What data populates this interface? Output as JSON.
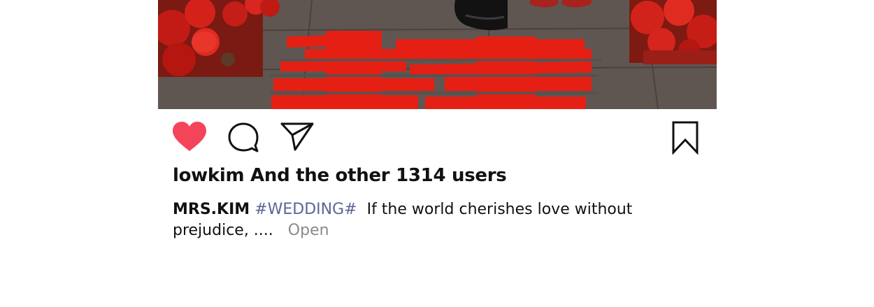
{
  "post": {
    "photo": {
      "description_icon": "wedding-photo"
    },
    "actions": {
      "like_icon": "heart-filled-icon",
      "comment_icon": "comment-bubble-icon",
      "share_icon": "paper-plane-icon",
      "bookmark_icon": "bookmark-icon",
      "like_color": "#f4445a"
    },
    "likes_text": "lowkim And the other 1314 users",
    "caption": {
      "username": "MRS.KIM",
      "hashtag": "#WEDDING#",
      "text": "If the world cherishes love without prejudice, ....",
      "more_label": "Open"
    },
    "colors": {
      "hashtag": "#5c6596",
      "more": "#8a8a8a",
      "text": "#111111"
    }
  }
}
